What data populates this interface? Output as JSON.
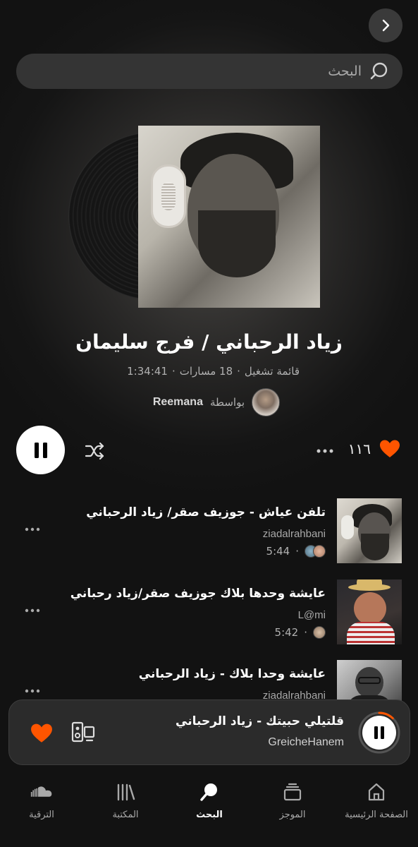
{
  "header": {
    "back_icon": "chevron-right-icon",
    "search_placeholder": "البحث"
  },
  "playlist": {
    "title": "زياد الرحباني / فرج سليمان",
    "type_label": "قائمة تشغيل",
    "tracks_count": "18 مسارات",
    "duration": "1:34:41",
    "by_label": "بواسطة",
    "owner": "Reemana",
    "likes": "١١٦"
  },
  "tracks": [
    {
      "title": "تلفن عياش - جوزيف صقر/ زياد الرحباني",
      "artist": "ziadalrahbani",
      "duration": "5:44",
      "avatars": 2
    },
    {
      "title": "عايشة وحدها بلاك  جوزيف صقر/زياد رحباني",
      "artist": "L@mi",
      "duration": "5:42",
      "avatars": 1
    },
    {
      "title": "عايشة وحدا بلاك - زياد الرحباني",
      "artist": "ziadalrahbani",
      "duration": "",
      "avatars": 0
    }
  ],
  "now_playing": {
    "title": "قلتيلي حبيتك - زياد الرحباني",
    "artist": "GreicheHanem",
    "progress": 0.12
  },
  "tabs": [
    {
      "label": "الصفحة الرئيسية",
      "icon": "home-icon"
    },
    {
      "label": "الموجز",
      "icon": "feed-icon"
    },
    {
      "label": "البحث",
      "icon": "search-icon",
      "active": true
    },
    {
      "label": "المكتبة",
      "icon": "library-icon"
    },
    {
      "label": "الترقية",
      "icon": "soundcloud-icon"
    }
  ],
  "colors": {
    "accent": "#ff5500",
    "background": "#121212",
    "surface": "#2b2b2b"
  }
}
